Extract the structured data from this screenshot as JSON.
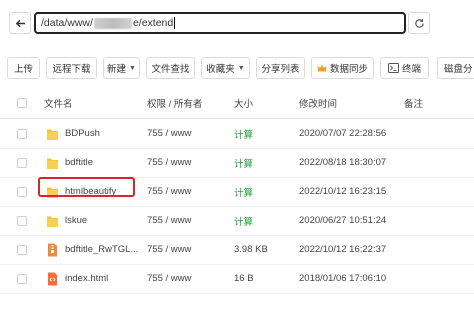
{
  "address": {
    "path_start": "/data/www/",
    "path_end": "e/extend"
  },
  "toolbar": {
    "upload": "上传",
    "remote_download": "远程下载",
    "new": "新建",
    "file_search": "文件查找",
    "favorites": "收藏夹",
    "share_list": "分享列表",
    "data_sync": "数据同步",
    "terminal": "终端",
    "disk": "磁盘分"
  },
  "table": {
    "headers": {
      "name": "文件名",
      "perm": "权限 / 所有者",
      "size": "大小",
      "mtime": "修改时间",
      "note": "备注"
    },
    "rows": [
      {
        "name": "BDPush",
        "type": "folder",
        "perm": "755 / www",
        "size": "计算",
        "size_is_action": true,
        "mtime": "2020/07/07 22:28:56"
      },
      {
        "name": "bdftitle",
        "type": "folder",
        "perm": "755 / www",
        "size": "计算",
        "size_is_action": true,
        "mtime": "2022/08/18 18:30:07"
      },
      {
        "name": "htmlbeautify",
        "type": "folder",
        "perm": "755 / www",
        "size": "计算",
        "size_is_action": true,
        "mtime": "2022/10/12 16:23:15"
      },
      {
        "name": "lskue",
        "type": "folder",
        "perm": "755 / www",
        "size": "计算",
        "size_is_action": true,
        "mtime": "2020/06/27 10:51:24"
      },
      {
        "name": "bdftitle_RwTGL...",
        "type": "file-zip",
        "perm": "755 / www",
        "size": "3.98 KB",
        "size_is_action": false,
        "mtime": "2022/10/12 16:22:37"
      },
      {
        "name": "index.html",
        "type": "file-html",
        "perm": "755 / www",
        "size": "16 B",
        "size_is_action": false,
        "mtime": "2018/01/06 17:06:10"
      }
    ]
  },
  "colors": {
    "accent_green": "#20a53a",
    "highlight_red": "#d9262a",
    "folder_yellow": "#f4c23b"
  }
}
